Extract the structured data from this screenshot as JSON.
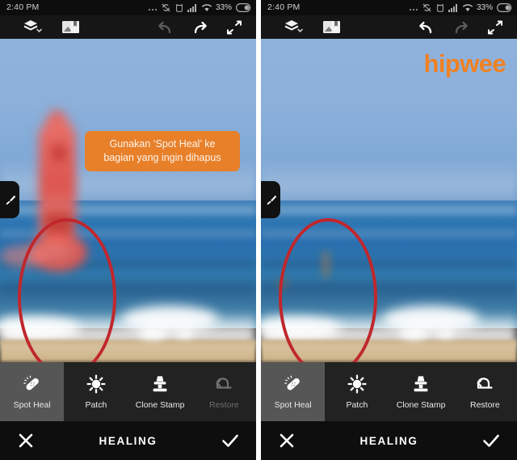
{
  "status_bar": {
    "time": "2:40 PM",
    "battery_percent": "33%",
    "icons": [
      "more-dots-icon",
      "sync-off-icon",
      "alarm-icon",
      "cellular-signal-icon",
      "wifi-icon",
      "battery-icon"
    ]
  },
  "top_toolbar": {
    "layers_label": "layers-icon",
    "photo_label": "photo-icon",
    "undo_label": "undo-icon",
    "redo_label": "redo-icon",
    "expand_label": "expand-icon"
  },
  "panels": [
    {
      "id": "before",
      "watermark": "",
      "tooltip": {
        "visible": true,
        "line1": "Gunakan ‘Spot Heal’ ke",
        "line2": "bagian yang ingin dihapus",
        "background": "#e8802a"
      },
      "undo_enabled": false,
      "redo_enabled": true,
      "restore_enabled": false,
      "subject_visible": true
    },
    {
      "id": "after",
      "watermark": "hipwee",
      "tooltip": {
        "visible": false,
        "line1": "",
        "line2": "",
        "background": "#e8802a"
      },
      "undo_enabled": true,
      "redo_enabled": false,
      "restore_enabled": true,
      "subject_visible": false
    }
  ],
  "tools": [
    {
      "label": "Spot Heal",
      "icon": "bandage-icon",
      "selected": true,
      "enabled": true
    },
    {
      "label": "Patch",
      "icon": "patch-sun-icon",
      "selected": false,
      "enabled": true
    },
    {
      "label": "Clone Stamp",
      "icon": "stamp-icon",
      "selected": false,
      "enabled": true
    },
    {
      "label": "Restore",
      "icon": "restore-arrow-icon",
      "selected": false,
      "enabled": false
    }
  ],
  "bottom_bar": {
    "title": "HEALING",
    "cancel_label": "close-icon",
    "confirm_label": "check-icon"
  },
  "brush_tab": {
    "icon": "brush-icon"
  },
  "colors": {
    "accent_orange": "#e8802a",
    "watermark_orange": "#f08122",
    "annotation_red": "#c0272d",
    "selected_tool_bg": "#565656",
    "toolbar_bg": "#222222",
    "bottom_bar_bg": "#0e0e0e"
  }
}
